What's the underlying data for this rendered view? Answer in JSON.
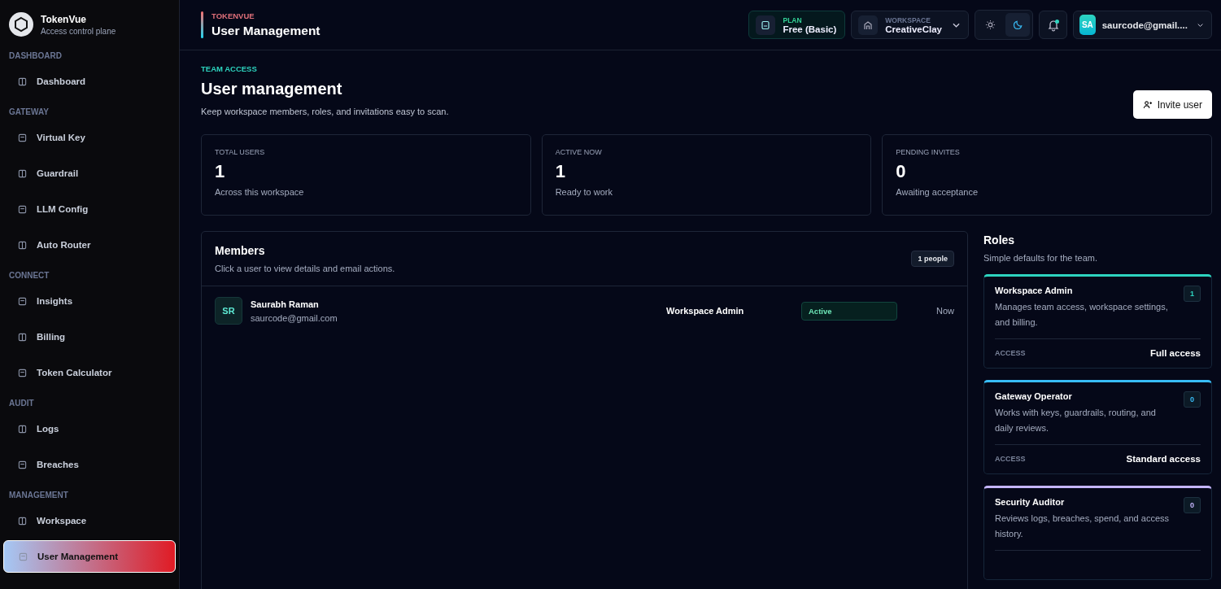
{
  "brand": {
    "name": "TokenVue",
    "tagline": "Access control plane"
  },
  "sidebar": {
    "sections": [
      {
        "heading": "DASHBOARD",
        "items": [
          {
            "label": "Dashboard",
            "selected": false
          }
        ]
      },
      {
        "heading": "GATEWAY",
        "items": [
          {
            "label": "Virtual Key",
            "selected": false
          },
          {
            "label": "Guardrail",
            "selected": false
          },
          {
            "label": "LLM Config",
            "selected": false
          },
          {
            "label": "Auto Router",
            "selected": false
          }
        ]
      },
      {
        "heading": "CONNECT",
        "items": [
          {
            "label": "Insights",
            "selected": false
          },
          {
            "label": "Billing",
            "selected": false
          },
          {
            "label": "Token Calculator",
            "selected": false
          }
        ]
      },
      {
        "heading": "AUDIT",
        "items": [
          {
            "label": "Logs",
            "selected": false
          },
          {
            "label": "Breaches",
            "selected": false
          }
        ]
      },
      {
        "heading": "MANAGEMENT",
        "items": [
          {
            "label": "Workspace",
            "selected": false
          },
          {
            "label": "User Management",
            "selected": true
          }
        ]
      }
    ]
  },
  "header": {
    "eyebrow": "TOKENVUE",
    "title": "User Management",
    "plan": {
      "label": "PLAN",
      "value": "Free (Basic)"
    },
    "workspace": {
      "label": "WORKSPACE",
      "value": "CreativeClay"
    },
    "theme_toggle": [
      {
        "selected": false
      },
      {
        "selected": true
      }
    ],
    "notifications": {
      "unread": true
    },
    "account": {
      "initials": "SA",
      "email": "saurcode@gmail...."
    }
  },
  "page": {
    "eyebrow": "TEAM ACCESS",
    "title": "User management",
    "subtitle": "Keep workspace members, roles, and invitations easy to scan.",
    "invite_button": "Invite user"
  },
  "stats": [
    {
      "label": "TOTAL USERS",
      "value": "1",
      "caption": "Across this workspace"
    },
    {
      "label": "ACTIVE NOW",
      "value": "1",
      "caption": "Ready to work"
    },
    {
      "label": "PENDING INVITES",
      "value": "0",
      "caption": "Awaiting acceptance"
    }
  ],
  "members": {
    "title": "Members",
    "subtitle": "Click a user to view details and email actions.",
    "count": "1 people",
    "rows": [
      {
        "initials": "SR",
        "name": "Saurabh Raman",
        "email": "saurcode@gmail.com",
        "role": "Workspace Admin",
        "status": "Active",
        "last_seen": "Now"
      }
    ]
  },
  "roles": {
    "title": "Roles",
    "subtitle": "Simple defaults for the team.",
    "items": [
      {
        "name": "Workspace Admin",
        "count": "1",
        "description": "Manages team access, workspace settings, and billing.",
        "access_label": "ACCESS",
        "access": "Full access",
        "color": "#2dd4bf"
      },
      {
        "name": "Gateway Operator",
        "count": "0",
        "description": "Works with keys, guardrails, routing, and daily reviews.",
        "access_label": "ACCESS",
        "access": "Standard access",
        "color": "#38bdf8"
      },
      {
        "name": "Security Auditor",
        "count": "0",
        "description": "Reviews logs, breaches, spend, and access history.",
        "color": "#c4b5fd"
      }
    ]
  }
}
